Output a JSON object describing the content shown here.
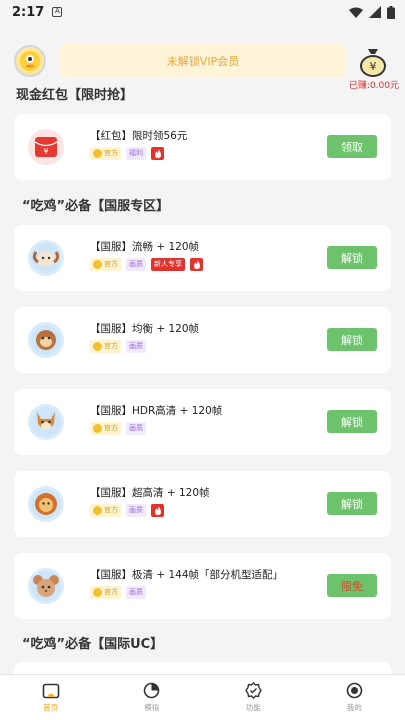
{
  "status": {
    "time": "2:17",
    "notif_icon": "A"
  },
  "header": {
    "vip_text": "未解锁VIP会员",
    "wallet_amount": "已赚:0.00元"
  },
  "sections": [
    {
      "title": "现金红包【限时抢】"
    },
    {
      "title": "“吃鸡”必备【国服专区】"
    },
    {
      "title": "“吃鸡”必备【国际UC】"
    }
  ],
  "cards": [
    {
      "title": "【红包】限时领56元",
      "tags": [
        "官方",
        "福利"
      ],
      "hot_label": "",
      "action": "领取"
    },
    {
      "title": "【国服】流畅 + 120帧",
      "tags": [
        "官方",
        "画质"
      ],
      "hot_label": "新人专享",
      "action": "解锁"
    },
    {
      "title": "【国服】均衡 + 120帧",
      "tags": [
        "官方",
        "画质"
      ],
      "hot_label": "",
      "action": "解锁"
    },
    {
      "title": "【国服】HDR高清 + 120帧",
      "tags": [
        "官方",
        "画质"
      ],
      "hot_label": "",
      "action": "解锁"
    },
    {
      "title": "【国服】超高清 + 120帧",
      "tags": [
        "官方",
        "画质"
      ],
      "hot_label": "",
      "action": "解锁"
    },
    {
      "title": "【国服】极清 + 144帧「部分机型适配」",
      "tags": [
        "官方",
        "画质"
      ],
      "hot_label": "",
      "action": "限免"
    }
  ],
  "nav": [
    {
      "label": "首页"
    },
    {
      "label": "模拟"
    },
    {
      "label": "功能"
    },
    {
      "label": "我的"
    }
  ],
  "colors": {
    "accent": "#6cc36b",
    "orange": "#e8a23a",
    "hot_red": "#e2332e"
  }
}
